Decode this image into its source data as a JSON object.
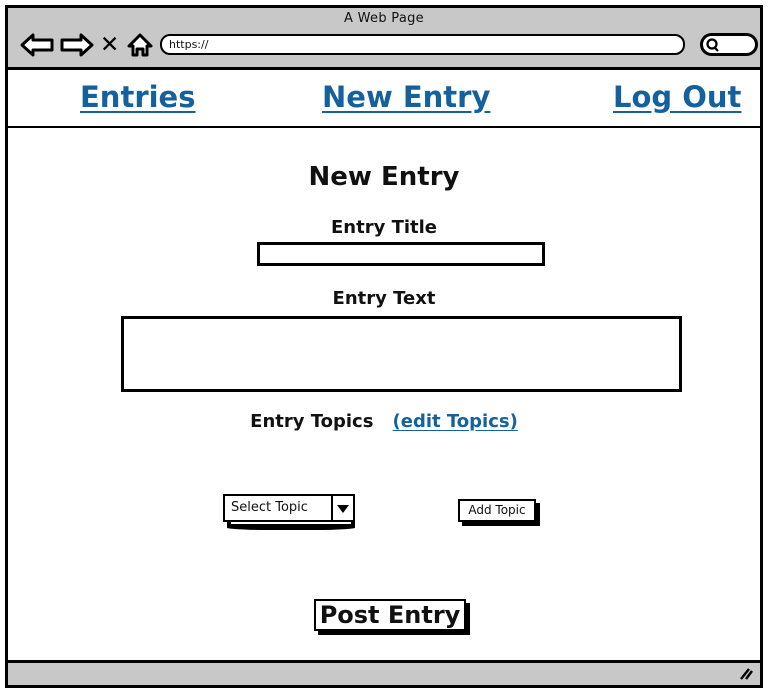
{
  "browser": {
    "window_title": "A Web Page",
    "url_value": "https://",
    "url_placeholder": "https://",
    "search_value": "",
    "toolbar_icons": [
      {
        "name": "back-arrow-icon",
        "glyph": "back"
      },
      {
        "name": "forward-arrow-icon",
        "glyph": "forward"
      },
      {
        "name": "stop-icon",
        "glyph": "X"
      },
      {
        "name": "home-icon",
        "glyph": "home"
      }
    ],
    "search_icon": "magnifier-icon",
    "resize_grip_icon": "resize-grip-icon"
  },
  "nav": {
    "links": [
      {
        "label": "Entries"
      },
      {
        "label": "New Entry"
      },
      {
        "label": "Log Out"
      }
    ]
  },
  "main": {
    "page_title": "New Entry",
    "entry_title": {
      "label": "Entry Title",
      "value": "",
      "placeholder": ""
    },
    "entry_text": {
      "label": "Entry Text",
      "value": "",
      "placeholder": ""
    },
    "topics": {
      "label": "Entry Topics",
      "edit_link": "(edit Topics)",
      "select_value": "Select Topic",
      "add_button": "Add Topic",
      "dropdown_arrow_icon": "chevron-down-icon"
    },
    "submit_button": "Post Entry"
  },
  "colors": {
    "link": "#15619e",
    "chrome": "#c8c8c8",
    "ink": "#000000",
    "page": "#ffffff"
  }
}
